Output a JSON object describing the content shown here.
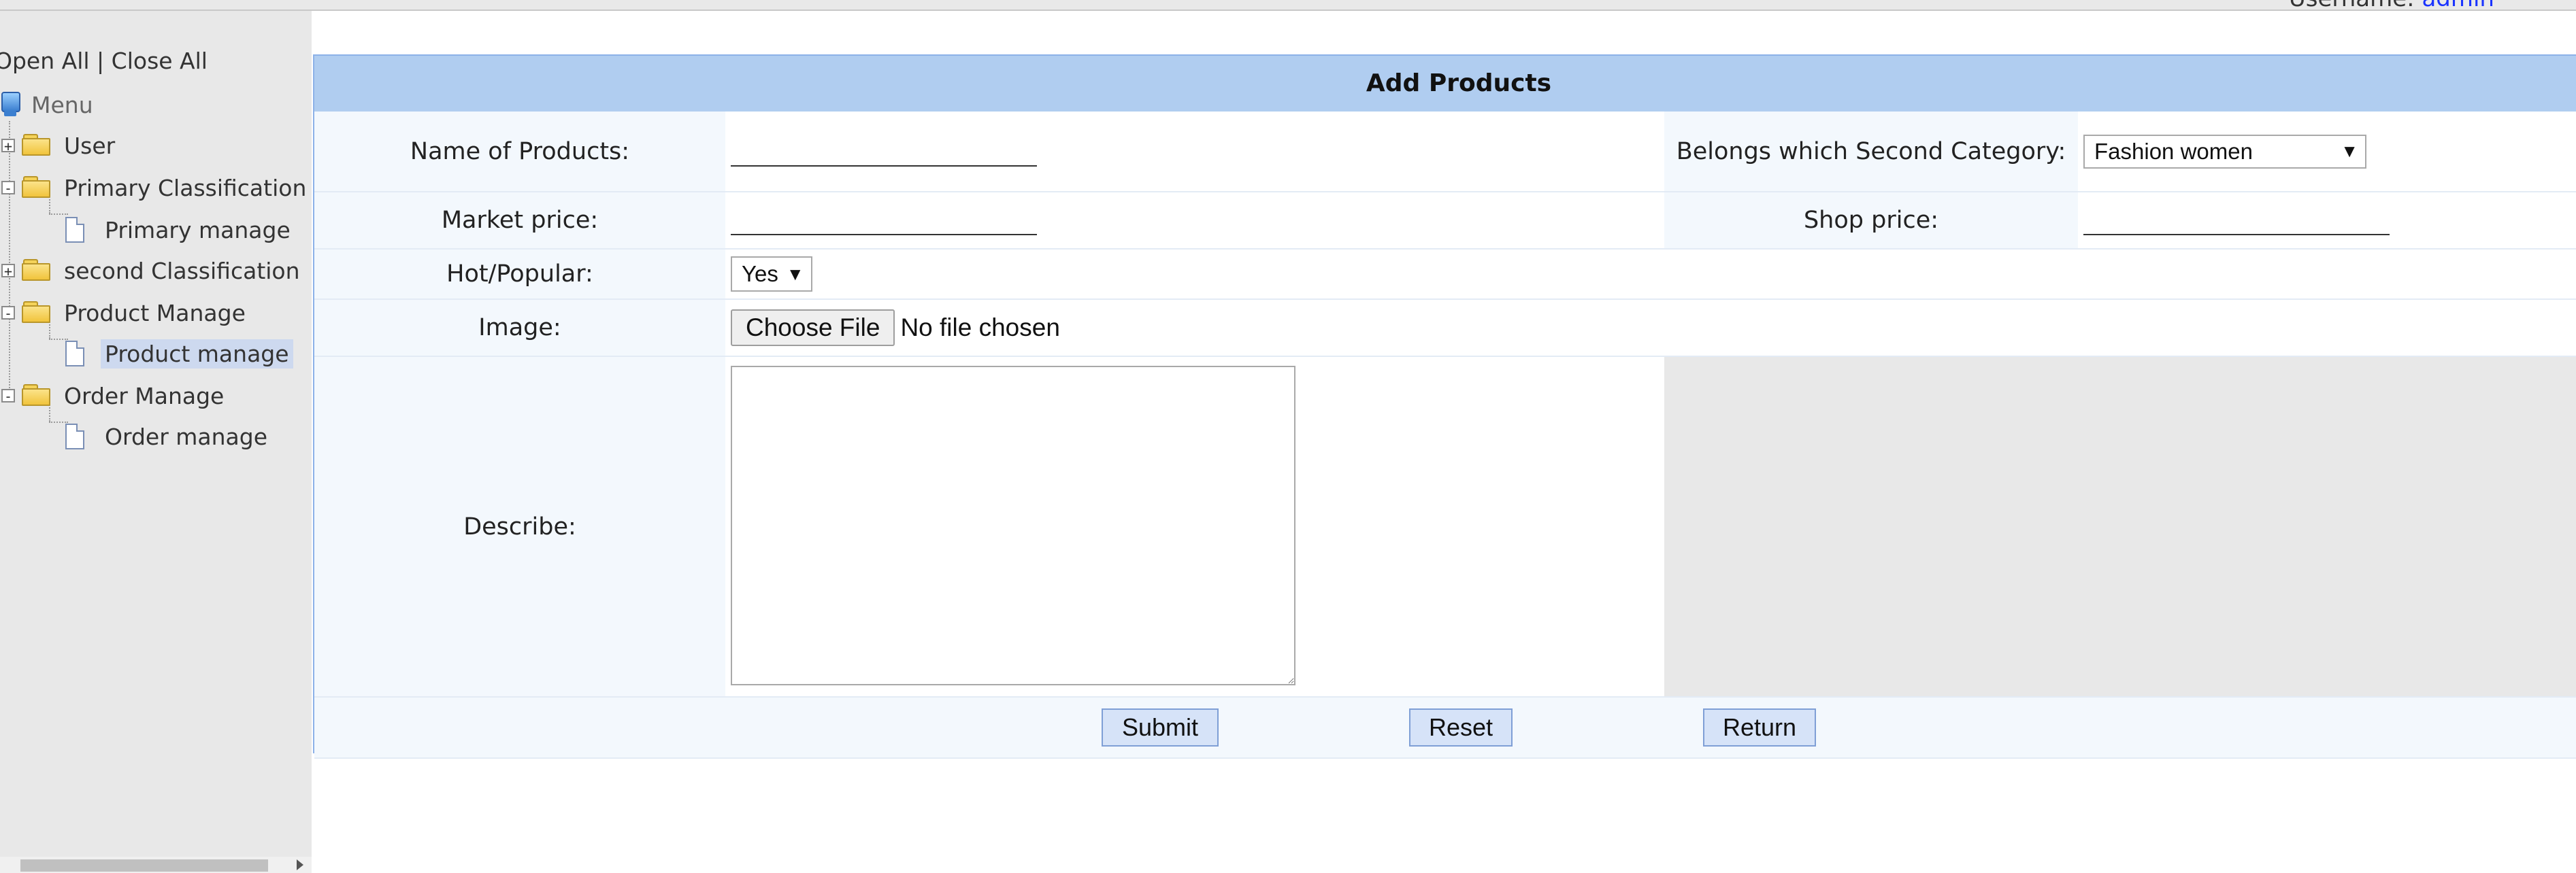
{
  "header": {
    "username_label": "Username:",
    "username_value": "admin"
  },
  "sidebar": {
    "open_all": "Open All",
    "separator": "|",
    "close_all": "Close All",
    "menu_label": "Menu",
    "items": [
      {
        "label": "User",
        "type": "folder",
        "expander": "+"
      },
      {
        "label": "Primary Classification",
        "type": "folder",
        "expander": "-"
      },
      {
        "label": "Primary manage",
        "type": "page"
      },
      {
        "label": "second Classification",
        "type": "folder",
        "expander": "+"
      },
      {
        "label": "Product Manage",
        "type": "folder",
        "expander": "-"
      },
      {
        "label": "Product manage",
        "type": "page",
        "selected": true
      },
      {
        "label": "Order Manage",
        "type": "folder",
        "expander": "-"
      },
      {
        "label": "Order manage",
        "type": "page"
      }
    ]
  },
  "form": {
    "title": "Add Products",
    "name_label": "Name of Products:",
    "name_value": "",
    "category_label": "Belongs which Second Category:",
    "category_value": "Fashion women",
    "market_price_label": "Market price:",
    "market_price_value": "",
    "shop_price_label": "Shop price:",
    "shop_price_value": "",
    "hot_label": "Hot/Popular:",
    "hot_value": "Yes",
    "image_label": "Image:",
    "choose_file": "Choose File",
    "file_status": "No file chosen",
    "describe_label": "Describe:",
    "describe_value": "",
    "submit": "Submit",
    "reset": "Reset",
    "return": "Return"
  },
  "colors": {
    "title_bar": "#b0cdf0",
    "label_bg": "#f3f8fd",
    "sidebar_bg": "#e8e8e8",
    "button_bg": "#d6e3f8",
    "selected_item": "#cdd9ef"
  }
}
